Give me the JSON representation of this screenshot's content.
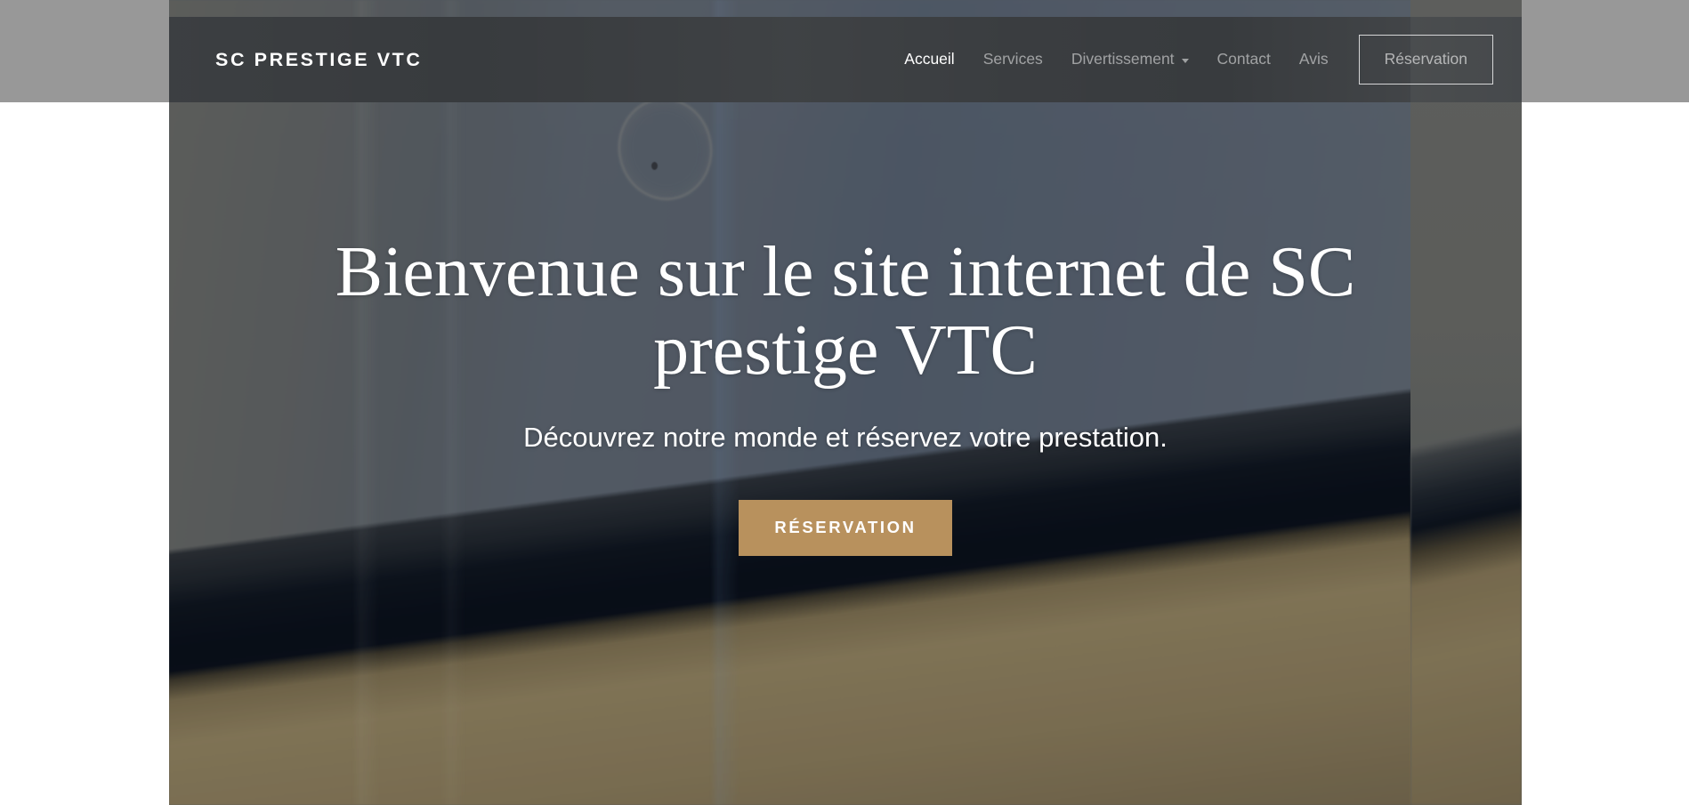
{
  "site": {
    "brand": "SC PRESTIGE VTC"
  },
  "header": {
    "nav_items": [
      {
        "label": "Accueil",
        "active": true,
        "has_dropdown": false
      },
      {
        "label": "Services",
        "active": false,
        "has_dropdown": false
      },
      {
        "label": "Divertissement",
        "active": false,
        "has_dropdown": true
      },
      {
        "label": "Contact",
        "active": false,
        "has_dropdown": false
      },
      {
        "label": "Avis",
        "active": false,
        "has_dropdown": false
      }
    ],
    "cta_label": "Réservation",
    "background_color": "#383b3e",
    "outer_band_color": "#989898"
  },
  "hero": {
    "title": "Bienvenue sur le site internet de SC prestige VTC",
    "subtitle": "Découvrez notre monde et réservez votre prestation.",
    "cta_label": "RÉSERVATION",
    "cta_color": "#b8915d",
    "background_description": "blurred photo looking through a vehicle windscreen over the dashboard"
  }
}
